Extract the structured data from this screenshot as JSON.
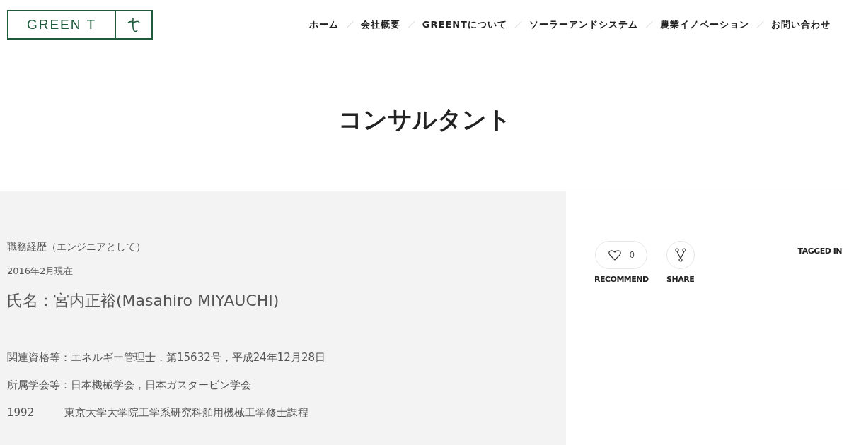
{
  "logo": {
    "text": "GREEN T"
  },
  "nav": [
    {
      "label": "ホーム"
    },
    {
      "label": "会社概要"
    },
    {
      "label": "GREENTについて"
    },
    {
      "label": "ソーラーアンドシステム"
    },
    {
      "label": "農業イノベーション"
    },
    {
      "label": "お問い合わせ"
    }
  ],
  "page_title": "コンサルタント",
  "article": {
    "heading": "職務経歴（エンジニアとして）",
    "date": "2016年2月現在",
    "name": "氏名：宮内正裕(Masahiro MIYAUCHI)",
    "lines": [
      {
        "text": "関連資格等：エネルギー管理士，第15632号，平成24年12月28日"
      },
      {
        "text": "所属学会等：日本機械学会，日本ガスタービン学会"
      }
    ],
    "history": [
      {
        "year": "1992",
        "text": "東京大学大学院工学系研究科舶用機械工学修士課程"
      }
    ]
  },
  "sidebar": {
    "recommend": {
      "count": "0",
      "label": "RECOMMEND"
    },
    "share": {
      "label": "SHARE"
    },
    "tagged": "TAGGED IN"
  }
}
